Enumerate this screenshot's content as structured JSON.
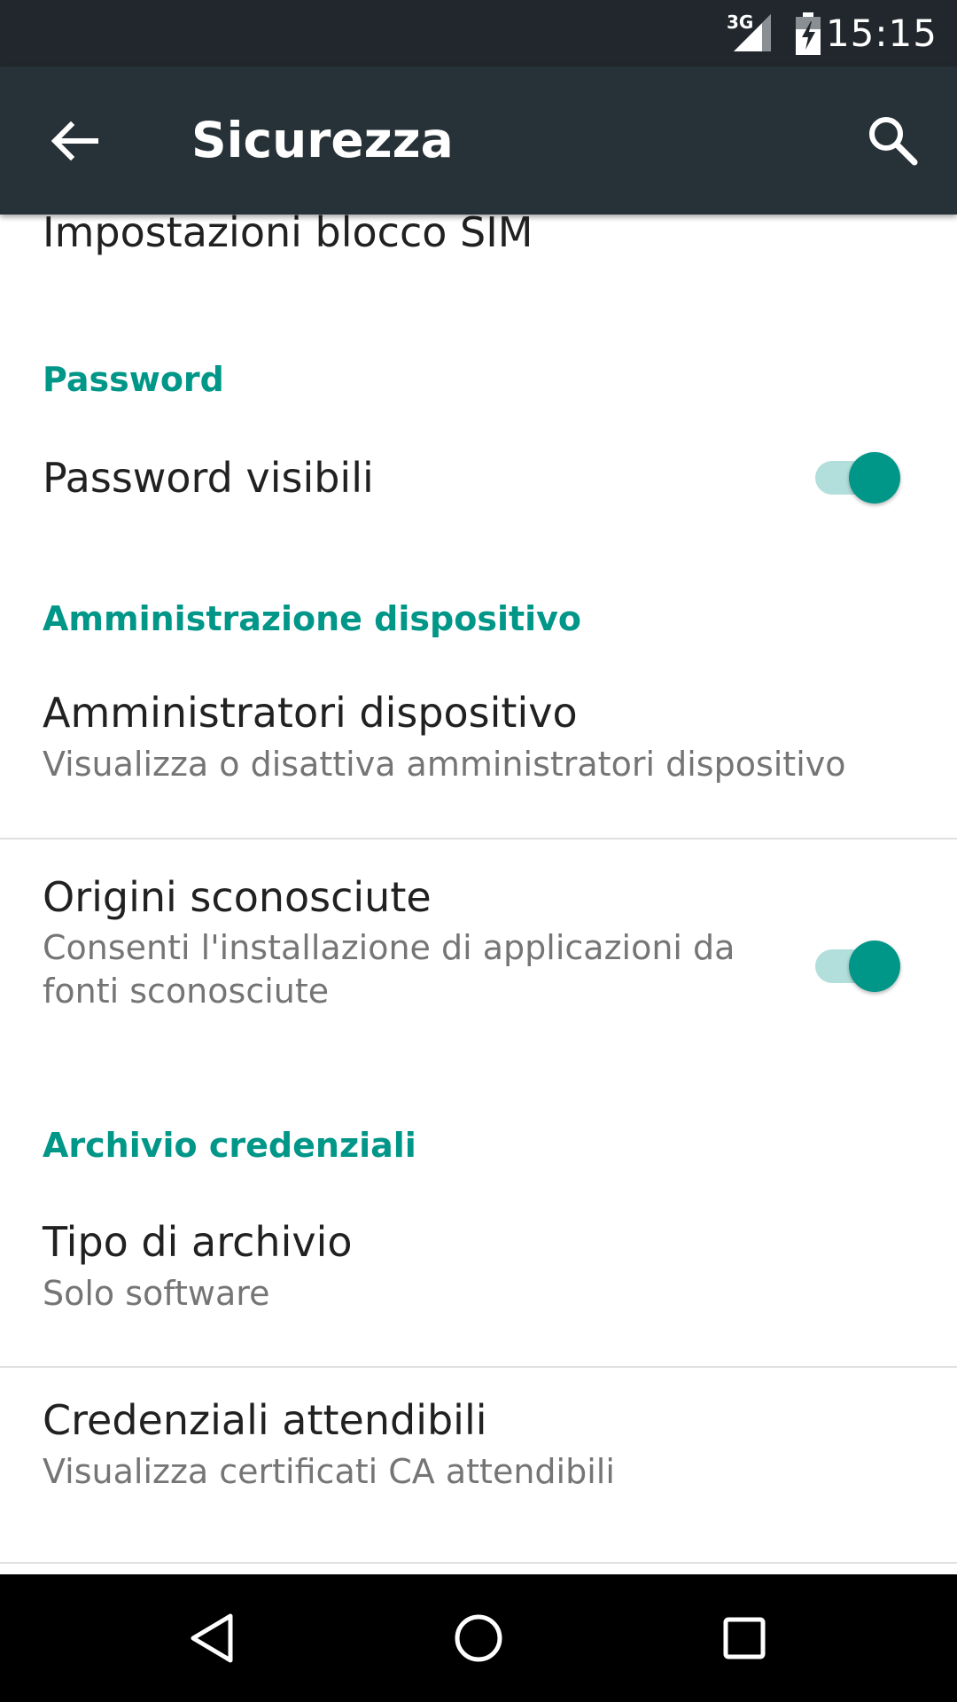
{
  "status_bar": {
    "network": "3G",
    "time": "15:15",
    "icons": [
      "signal-3g-icon",
      "battery-charging-icon"
    ]
  },
  "toolbar": {
    "title": "Sicurezza",
    "back_icon": "arrow-back-icon",
    "search_icon": "search-icon"
  },
  "rows": {
    "sim_lock": {
      "title": "Impostazioni blocco SIM"
    },
    "password_section": "Password",
    "visible_passwords": {
      "title": "Password visibili",
      "enabled": true
    },
    "device_admin_section": "Amministrazione dispositivo",
    "device_admins": {
      "title": "Amministratori dispositivo",
      "subtitle": "Visualizza o disattiva amministratori dispositivo"
    },
    "unknown_sources": {
      "title": "Origini sconosciute",
      "subtitle_line1": "Consenti l'installazione di applicazioni da",
      "subtitle_line2": "fonti sconosciute",
      "enabled": true
    },
    "credential_section": "Archivio credenziali",
    "storage_type": {
      "title": "Tipo di archivio",
      "subtitle": "Solo software"
    },
    "trusted_credentials": {
      "title": "Credenziali attendibili",
      "subtitle": "Visualizza certificati CA attendibili"
    }
  },
  "nav_bar": {
    "icons": [
      "back-triangle-icon",
      "home-circle-icon",
      "recents-square-icon"
    ]
  },
  "colors": {
    "accent": "#009688",
    "accent_light": "#b2dfdb",
    "toolbar": "#273238",
    "status_bar": "#21272c"
  }
}
